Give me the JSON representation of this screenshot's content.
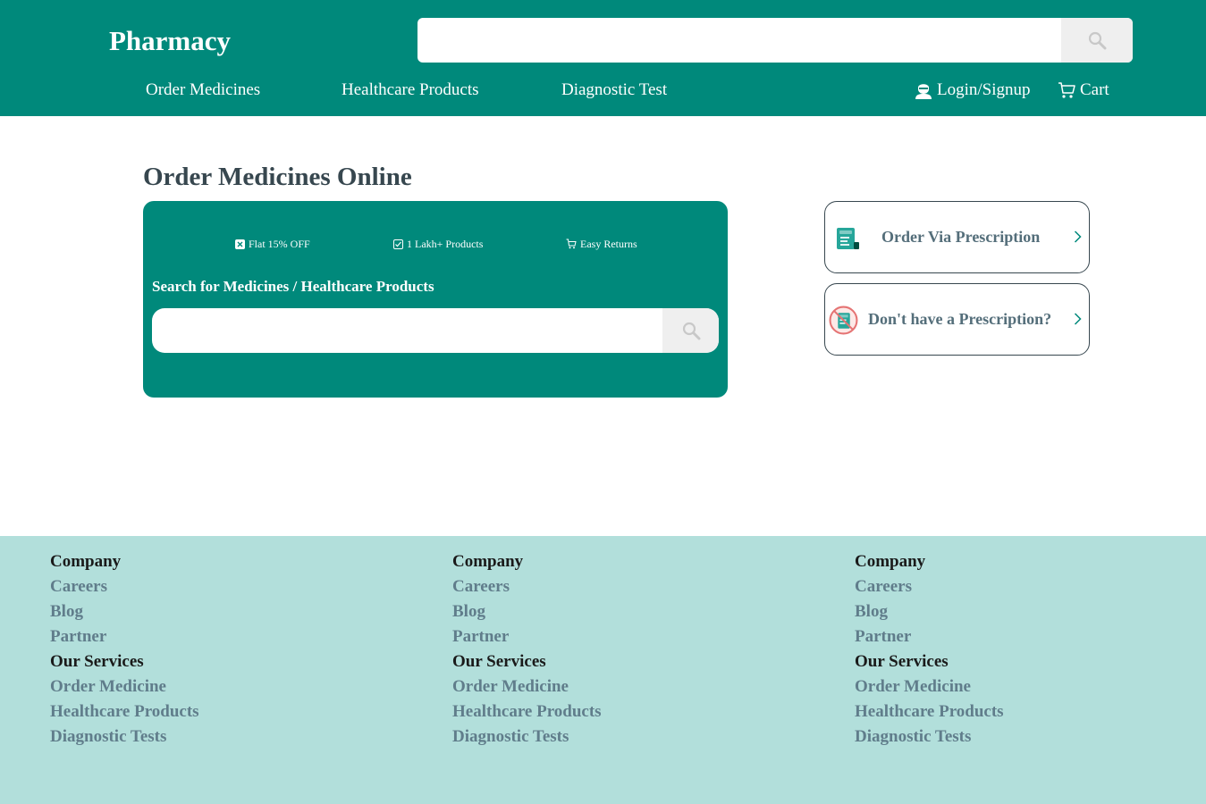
{
  "header": {
    "brand": "Pharmacy",
    "search_placeholder": "",
    "nav": [
      "Order Medicines",
      "Healthcare Products",
      "Diagnostic Test"
    ],
    "login": "Login/Signup",
    "cart": "Cart"
  },
  "main": {
    "title": "Order Medicines Online",
    "features": [
      "Flat 15% OFF",
      "1 Lakh+ Products",
      "Easy Returns"
    ],
    "search_label": "Search for Medicines / Healthcare Products",
    "search_placeholder": "",
    "prescription_options": [
      "Order Via Prescription",
      "Don't have a Prescription?"
    ]
  },
  "footer": {
    "columns": [
      {
        "company_heading": "Company",
        "company_links": [
          "Careers",
          "Blog",
          "Partner"
        ],
        "services_heading": "Our Services",
        "services_links": [
          "Order Medicine",
          "Healthcare Products",
          "Diagnostic Tests"
        ]
      },
      {
        "company_heading": "Company",
        "company_links": [
          "Careers",
          "Blog",
          "Partner"
        ],
        "services_heading": "Our Services",
        "services_links": [
          "Order Medicine",
          "Healthcare Products",
          "Diagnostic Tests"
        ]
      },
      {
        "company_heading": "Company",
        "company_links": [
          "Careers",
          "Blog",
          "Partner"
        ],
        "services_heading": "Our Services",
        "services_links": [
          "Order Medicine",
          "Healthcare Products",
          "Diagnostic Tests"
        ]
      }
    ]
  },
  "colors": {
    "primary": "#00897b",
    "footer_bg": "#b2dfdb",
    "title": "#37474f",
    "footer_link": "#607d8b"
  },
  "icons": [
    "search-icon",
    "user-icon",
    "cart-icon",
    "discount-icon",
    "check-icon",
    "returns-cart-icon",
    "prescription-icon",
    "no-prescription-icon",
    "chevron-right-icon"
  ]
}
